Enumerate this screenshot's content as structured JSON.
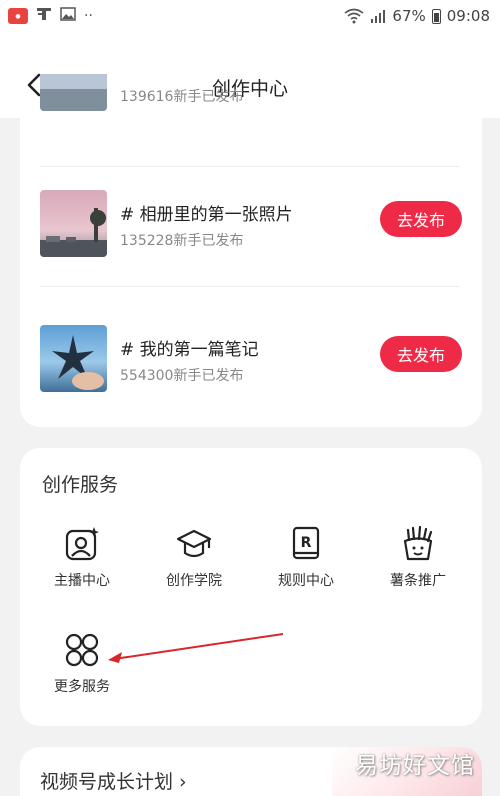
{
  "status_bar": {
    "battery": "67%",
    "time": "09:08",
    "dots": "··"
  },
  "header": {
    "title": "创作中心"
  },
  "tasks": [
    {
      "title": "",
      "meta": "139616新手已发布"
    },
    {
      "title": "# 相册里的第一张照片",
      "meta": "135228新手已发布",
      "button": "去发布"
    },
    {
      "title": "# 我的第一篇笔记",
      "meta": "554300新手已发布",
      "button": "去发布"
    }
  ],
  "services": {
    "title": "创作服务",
    "items": [
      {
        "label": "主播中心",
        "icon": "streamer-icon"
      },
      {
        "label": "创作学院",
        "icon": "graduation-cap-icon"
      },
      {
        "label": "规则中心",
        "icon": "rules-book-icon"
      },
      {
        "label": "薯条推广",
        "icon": "fries-icon"
      },
      {
        "label": "更多服务",
        "icon": "more-grid-icon"
      }
    ]
  },
  "growth": {
    "title": "视频号成长计划 ›"
  },
  "watermark": "易坊好文馆",
  "colors": {
    "accent": "#ee2a47",
    "annotation_arrow": "#d9262b"
  }
}
